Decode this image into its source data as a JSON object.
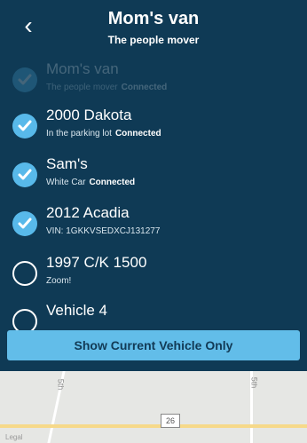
{
  "header": {
    "back_glyph": "‹",
    "title": "Mom's van",
    "subtitle": "The people mover"
  },
  "vehicles": [
    {
      "name": "Mom's van",
      "detail": "The people mover",
      "status": "Connected",
      "selected": true,
      "faded": true
    },
    {
      "name": "2000 Dakota",
      "detail": "In the parking lot",
      "status": "Connected",
      "selected": true,
      "faded": false
    },
    {
      "name": "Sam's",
      "detail": "White Car",
      "status": "Connected",
      "selected": true,
      "faded": false
    },
    {
      "name": "2012 Acadia",
      "detail": "VIN: 1GKKVSEDXCJ131277",
      "status": "",
      "selected": true,
      "faded": false
    },
    {
      "name": "1997 C/K 1500",
      "detail": "Zoom!",
      "status": "",
      "selected": false,
      "faded": false
    },
    {
      "name": "Vehicle 4",
      "detail": "",
      "status": "",
      "selected": false,
      "faded": false
    }
  ],
  "bottom_button": "Show Current Vehicle Only",
  "map": {
    "street_1": "5th",
    "street_2": "5th",
    "route": "26",
    "corner": "Legal"
  },
  "colors": {
    "panel": "#0f3a55",
    "accent": "#58b9ea",
    "button": "#62bde9"
  }
}
